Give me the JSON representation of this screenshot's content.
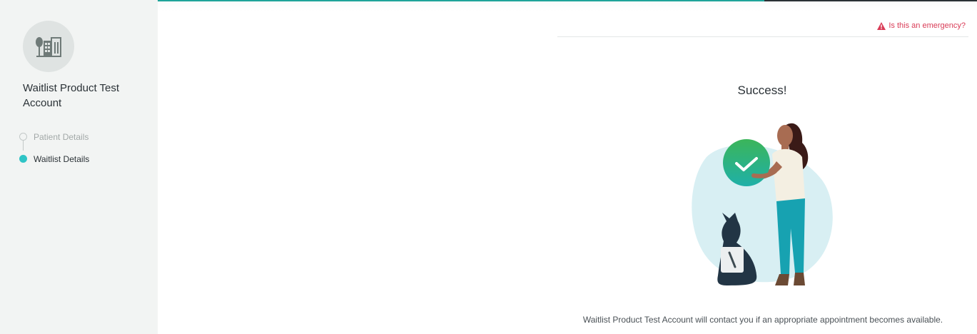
{
  "sidebar": {
    "clinic_name": "Waitlist Product Test Account",
    "avatar_icon": "clinic-building-icon",
    "steps": [
      {
        "label": "Patient Details",
        "state": "completed"
      },
      {
        "label": "Waitlist Details",
        "state": "active"
      }
    ]
  },
  "header": {
    "progress_fraction": 0.74,
    "emergency_link": "Is this an emergency?",
    "emergency_icon": "warning-triangle-icon",
    "colors": {
      "progress": "#1fa49a",
      "emergency": "#d93b56",
      "active_step": "#2fc4c6"
    }
  },
  "main": {
    "title": "Success!",
    "illustration": "woman-with-checkmark-and-dog-illustration",
    "message": "Waitlist Product Test Account will contact you if an appropriate appointment becomes available."
  }
}
